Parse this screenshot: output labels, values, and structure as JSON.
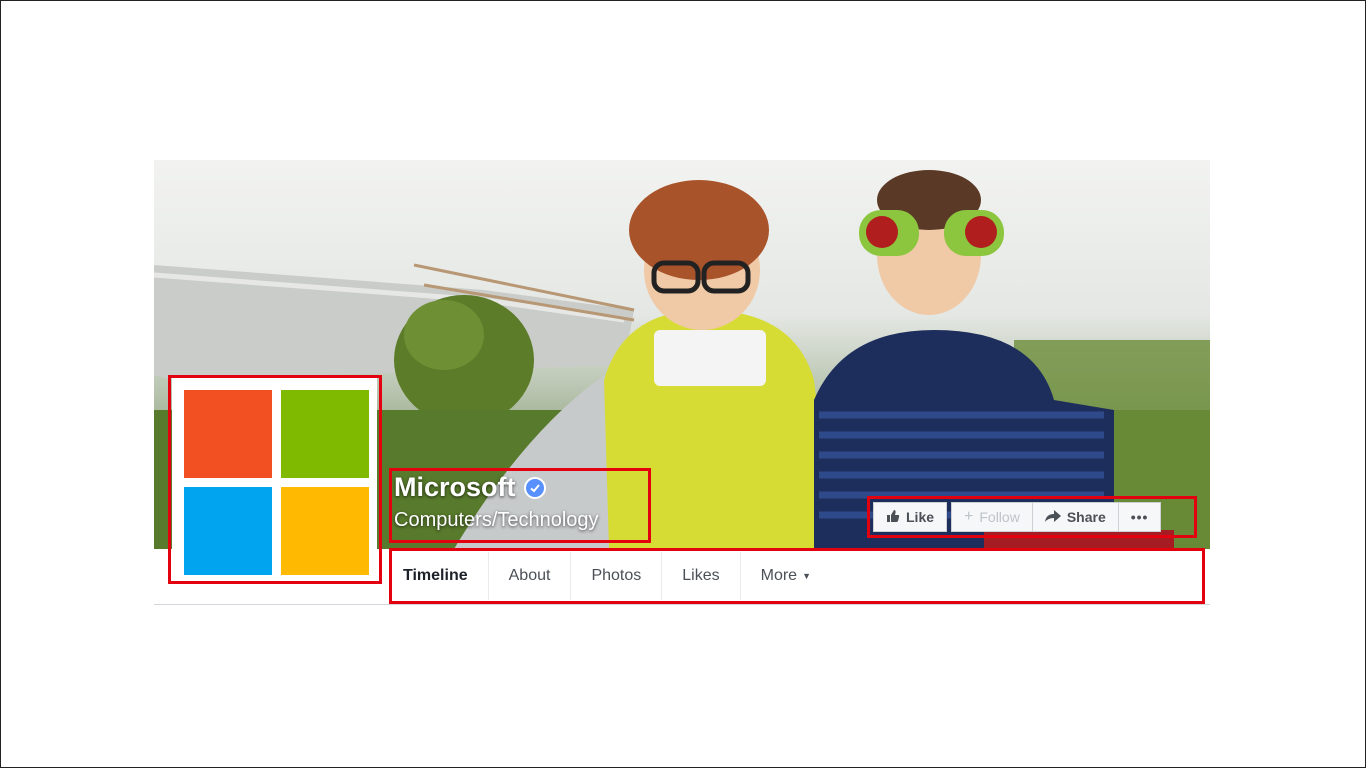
{
  "page": {
    "name": "Microsoft",
    "category": "Computers/Technology"
  },
  "actions": {
    "like_label": "Like",
    "follow_label": "Follow",
    "share_label": "Share",
    "more_label": "•••"
  },
  "tabs": [
    {
      "label": "Timeline"
    },
    {
      "label": "About"
    },
    {
      "label": "Photos"
    },
    {
      "label": "Likes"
    },
    {
      "label": "More"
    }
  ],
  "colors": {
    "highlight": "#e3000f",
    "logo_red": "#f25022",
    "logo_green": "#7fba00",
    "logo_blue": "#00a4ef",
    "logo_yellow": "#ffb900",
    "verified_badge": "#5890ff"
  },
  "icons": [
    "verified-badge-icon",
    "thumbs-up-icon",
    "plus-icon",
    "share-arrow-icon",
    "more-dots-icon",
    "caret-down-icon"
  ]
}
